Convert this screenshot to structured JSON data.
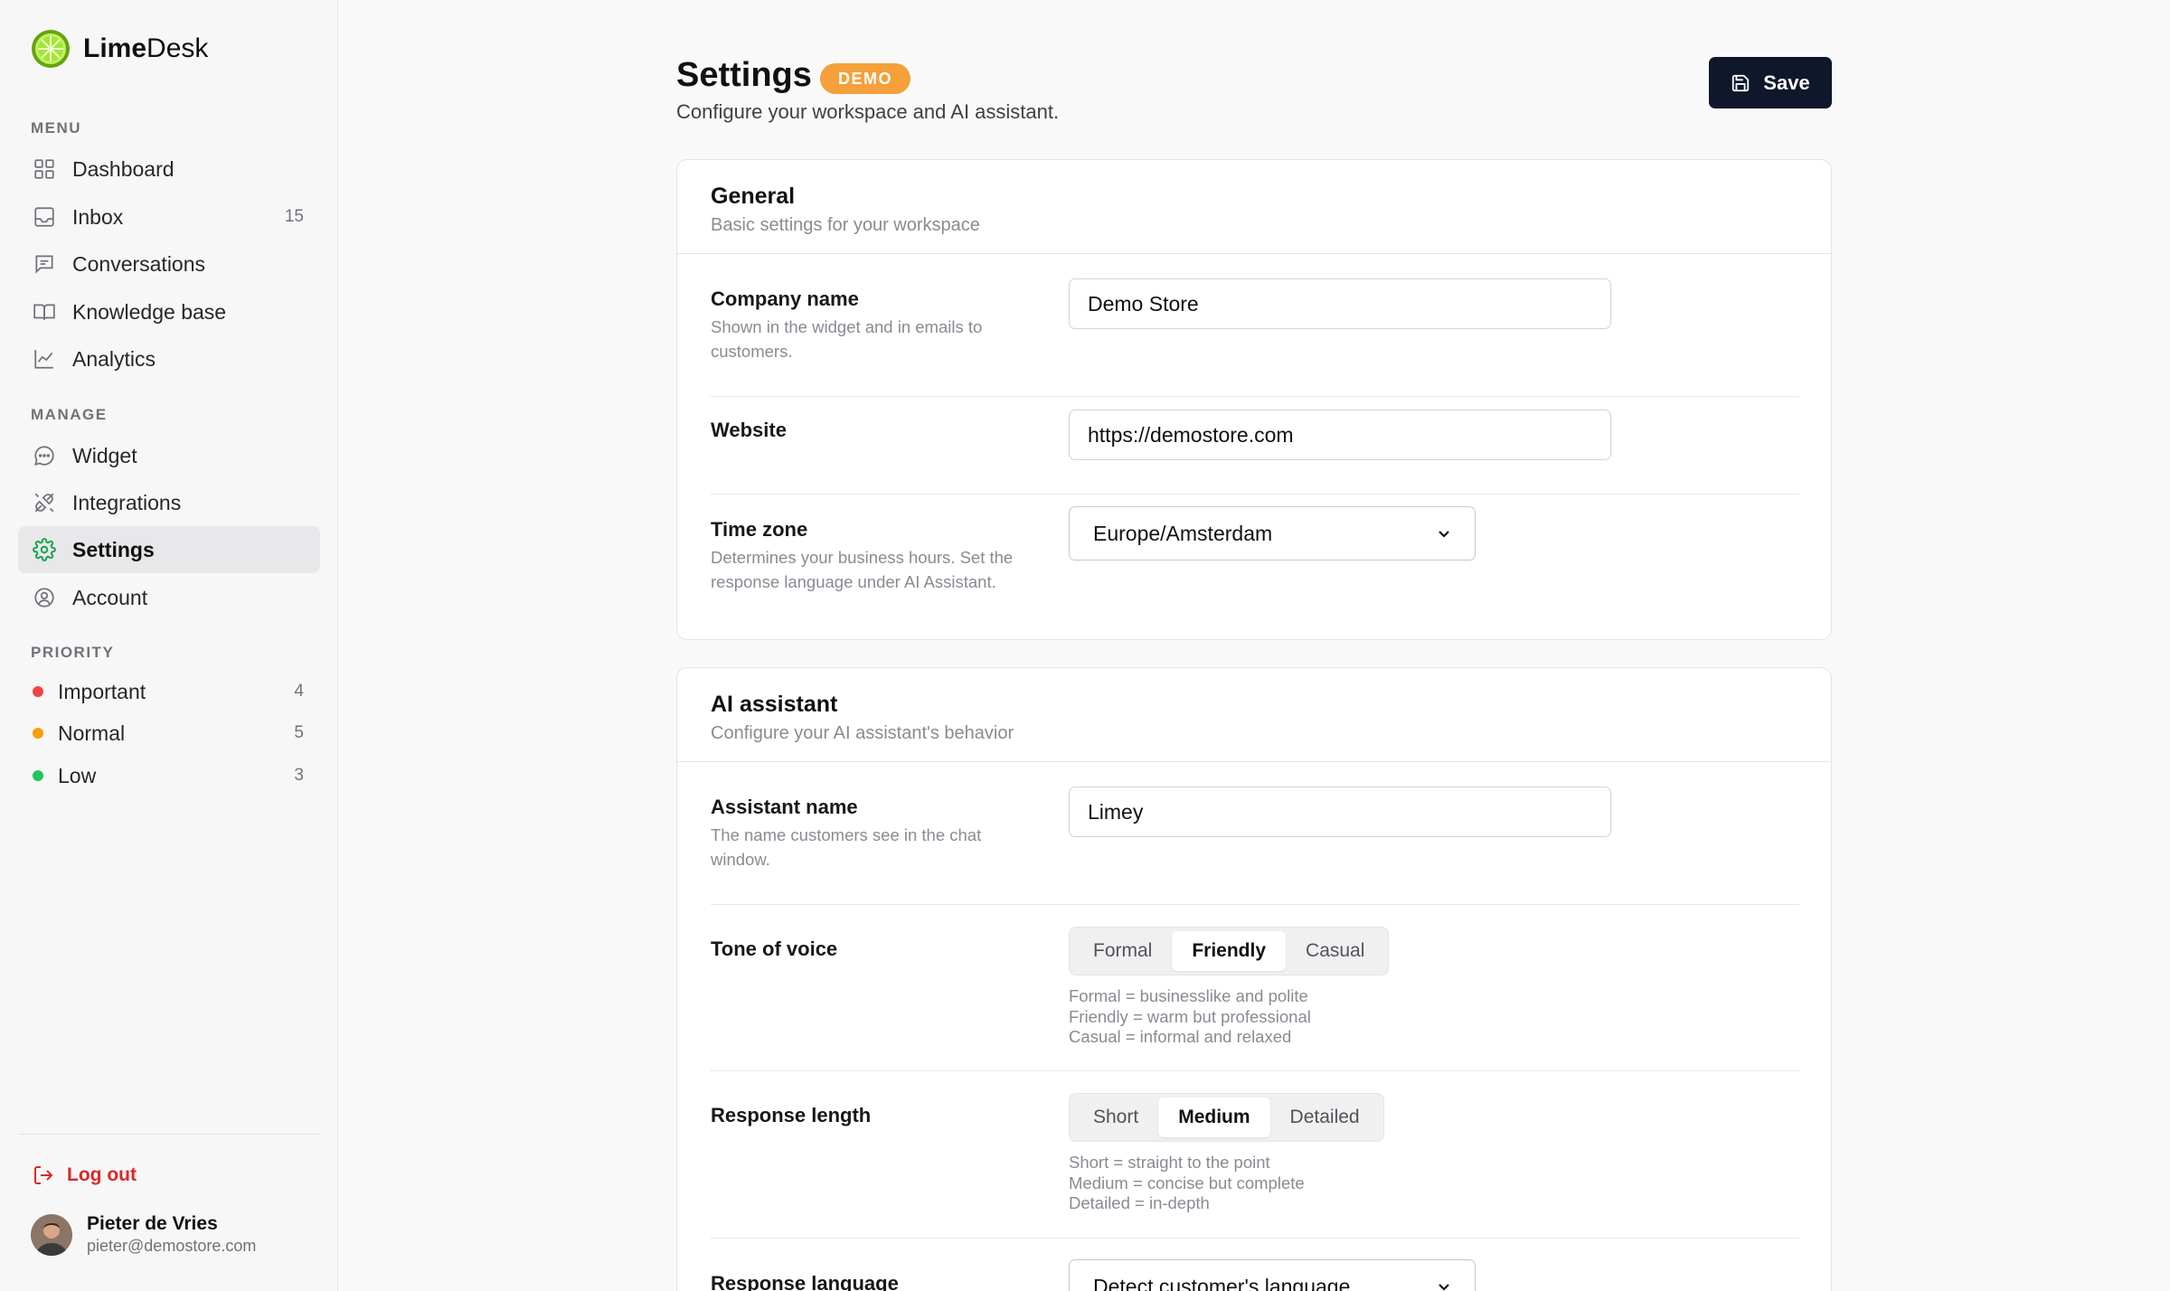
{
  "brand": {
    "name_bold": "Lime",
    "name_rest": "Desk",
    "accent": "#84cc16"
  },
  "sidebar": {
    "menu_label": "MENU",
    "menu": [
      {
        "label": "Dashboard",
        "icon": "grid-icon",
        "count": ""
      },
      {
        "label": "Inbox",
        "icon": "inbox-icon",
        "count": "15"
      },
      {
        "label": "Conversations",
        "icon": "message-square-icon",
        "count": ""
      },
      {
        "label": "Knowledge base",
        "icon": "book-open-icon",
        "count": ""
      },
      {
        "label": "Analytics",
        "icon": "chart-line-icon",
        "count": ""
      }
    ],
    "manage_label": "MANAGE",
    "manage": [
      {
        "label": "Widget",
        "icon": "message-circle-icon"
      },
      {
        "label": "Integrations",
        "icon": "plug-icon"
      },
      {
        "label": "Settings",
        "icon": "gear-icon",
        "active": true
      },
      {
        "label": "Account",
        "icon": "user-circle-icon"
      }
    ],
    "priority_label": "PRIORITY",
    "priority": [
      {
        "label": "Important",
        "count": "4",
        "color": "#ef4444"
      },
      {
        "label": "Normal",
        "count": "5",
        "color": "#f59e0b"
      },
      {
        "label": "Low",
        "count": "3",
        "color": "#22c55e"
      }
    ],
    "logout_label": "Log out",
    "user": {
      "name": "Pieter de Vries",
      "email": "pieter@demostore.com"
    }
  },
  "header": {
    "title": "Settings",
    "badge": "DEMO",
    "subtitle": "Configure your workspace and AI assistant.",
    "save_label": "Save"
  },
  "general": {
    "title": "General",
    "subtitle": "Basic settings for your workspace",
    "company_label": "Company name",
    "company_help": "Shown in the widget and in emails to customers.",
    "company_value": "Demo Store",
    "website_label": "Website",
    "website_value": "https://demostore.com",
    "timezone_label": "Time zone",
    "timezone_help": "Determines your business hours. Set the response language under AI Assistant.",
    "timezone_value": "Europe/Amsterdam"
  },
  "ai": {
    "title": "AI assistant",
    "subtitle": "Configure your AI assistant's behavior",
    "name_label": "Assistant name",
    "name_help": "The name customers see in the chat window.",
    "name_value": "Limey",
    "tone_label": "Tone of voice",
    "tone_options": [
      "Formal",
      "Friendly",
      "Casual"
    ],
    "tone_selected": "Friendly",
    "tone_help": [
      "Formal = businesslike and polite",
      "Friendly = warm but professional",
      "Casual = informal and relaxed"
    ],
    "length_label": "Response length",
    "length_options": [
      "Short",
      "Medium",
      "Detailed"
    ],
    "length_selected": "Medium",
    "length_help": [
      "Short = straight to the point",
      "Medium = concise but complete",
      "Detailed = in-depth"
    ],
    "language_label": "Response language",
    "language_value": "Detect customer's language"
  }
}
